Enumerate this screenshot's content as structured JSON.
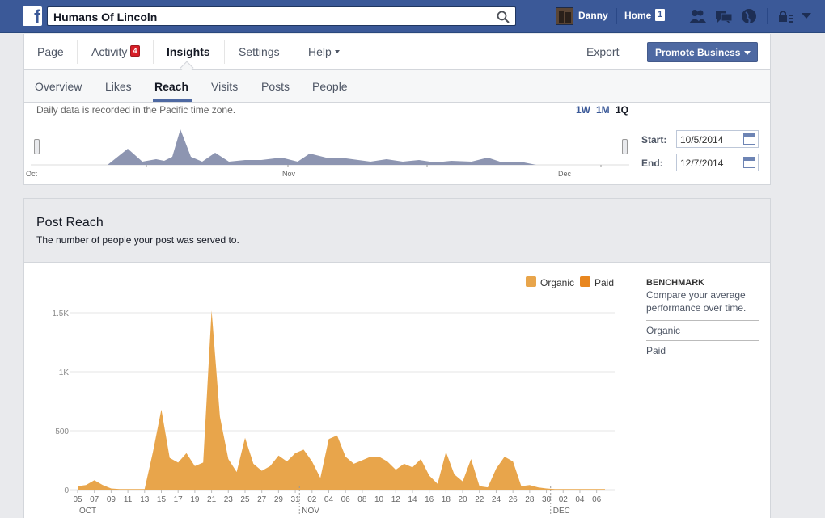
{
  "topbar": {
    "search_value": "Humans Of Lincoln",
    "user_name": "Danny",
    "home_label": "Home",
    "home_count": "1",
    "icons": [
      "facebook-logo-icon",
      "search-icon",
      "friend-requests-icon",
      "messages-icon",
      "notifications-globe-icon",
      "privacy-shortcuts-icon",
      "account-caret-icon"
    ]
  },
  "page_nav": {
    "items": [
      "Page",
      "Activity",
      "Insights",
      "Settings",
      "Help"
    ],
    "active": "Insights",
    "activity_badge": "4",
    "export_label": "Export",
    "promote_label": "Promote Business"
  },
  "sub_nav": {
    "items": [
      "Overview",
      "Likes",
      "Reach",
      "Visits",
      "Posts",
      "People"
    ],
    "active": "Reach"
  },
  "timeline": {
    "tz_note": "Daily data is recorded in the Pacific time zone.",
    "ranges": [
      "1W",
      "1M",
      "1Q"
    ],
    "active_range": "1Q",
    "months": [
      "Oct",
      "Nov",
      "Dec"
    ],
    "start_label": "Start:",
    "start_value": "10/5/2014",
    "end_label": "End:",
    "end_value": "12/7/2014"
  },
  "post_reach": {
    "title": "Post Reach",
    "subtitle": "The number of people your post was served to.",
    "legend": [
      {
        "name": "Organic",
        "color": "#e8a54b"
      },
      {
        "name": "Paid",
        "color": "#e8861f"
      }
    ],
    "benchmark_title": "BENCHMARK",
    "benchmark_desc": "Compare your average performance over time.",
    "benchmark_items": [
      "Organic",
      "Paid"
    ]
  },
  "chart_data": {
    "type": "area",
    "x": [
      "05",
      "06",
      "07",
      "08",
      "09",
      "10",
      "11",
      "12",
      "13",
      "14",
      "15",
      "16",
      "17",
      "18",
      "19",
      "20",
      "21",
      "22",
      "23",
      "24",
      "25",
      "26",
      "27",
      "28",
      "29",
      "30",
      "31",
      "01",
      "02",
      "03",
      "04",
      "05",
      "06",
      "07",
      "08",
      "09",
      "10",
      "11",
      "12",
      "13",
      "14",
      "15",
      "16",
      "17",
      "18",
      "19",
      "20",
      "21",
      "22",
      "23",
      "24",
      "25",
      "26",
      "27",
      "28",
      "29",
      "30",
      "01",
      "02",
      "03",
      "04",
      "05",
      "06",
      "07"
    ],
    "x_tick_labels": [
      "05",
      "07",
      "09",
      "11",
      "13",
      "15",
      "17",
      "19",
      "21",
      "23",
      "25",
      "27",
      "29",
      "31",
      "02",
      "04",
      "06",
      "08",
      "10",
      "12",
      "14",
      "16",
      "18",
      "20",
      "22",
      "24",
      "26",
      "28",
      "30",
      "02",
      "04",
      "06"
    ],
    "month_labels": [
      "OCT",
      "NOV",
      "DEC"
    ],
    "y_ticks": [
      "0",
      "500",
      "1K",
      "1.5K"
    ],
    "ylim": [
      0,
      1500
    ],
    "series": [
      {
        "name": "Organic",
        "color": "#e8a54b",
        "values": [
          30,
          40,
          80,
          40,
          10,
          5,
          5,
          5,
          5,
          320,
          680,
          270,
          230,
          310,
          200,
          230,
          1520,
          620,
          260,
          150,
          440,
          220,
          160,
          200,
          290,
          240,
          310,
          340,
          240,
          100,
          430,
          460,
          280,
          220,
          250,
          280,
          280,
          240,
          170,
          220,
          190,
          260,
          120,
          50,
          320,
          130,
          70,
          260,
          30,
          20,
          180,
          280,
          240,
          30,
          40,
          20,
          10,
          5,
          5,
          5,
          5,
          5,
          5,
          5
        ]
      },
      {
        "name": "Paid",
        "color": "#e8861f",
        "values": [
          0,
          0,
          0,
          0,
          0,
          0,
          0,
          0,
          0,
          0,
          0,
          0,
          0,
          0,
          0,
          0,
          0,
          0,
          0,
          0,
          0,
          0,
          0,
          0,
          0,
          0,
          0,
          0,
          0,
          0,
          0,
          0,
          0,
          0,
          0,
          0,
          0,
          0,
          0,
          0,
          0,
          0,
          0,
          0,
          0,
          0,
          0,
          0,
          0,
          0,
          0,
          0,
          0,
          0,
          0,
          0,
          0,
          0,
          0,
          0,
          0,
          0,
          0,
          0
        ]
      }
    ]
  }
}
